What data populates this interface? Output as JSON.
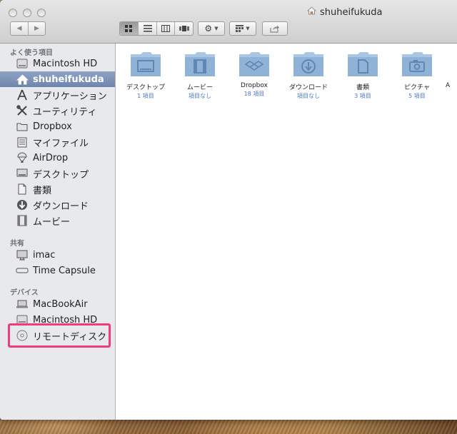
{
  "window": {
    "title": "shuheifukuda"
  },
  "toolbar": {
    "back_label": "◀",
    "forward_label": "▶"
  },
  "sidebar": {
    "favorites_title": "よく使う項目",
    "favorites": [
      {
        "label": "Macintosh HD",
        "icon": "hard-drive-icon"
      },
      {
        "label": "shuheifukuda",
        "icon": "home-icon",
        "selected": true
      },
      {
        "label": "アプリケーション",
        "icon": "applications-icon"
      },
      {
        "label": "ユーティリティ",
        "icon": "utilities-icon"
      },
      {
        "label": "Dropbox",
        "icon": "folder-icon"
      },
      {
        "label": "マイファイル",
        "icon": "all-my-files-icon"
      },
      {
        "label": "AirDrop",
        "icon": "airdrop-icon"
      },
      {
        "label": "デスクトップ",
        "icon": "desktop-icon"
      },
      {
        "label": "書類",
        "icon": "documents-icon"
      },
      {
        "label": "ダウンロード",
        "icon": "downloads-icon"
      },
      {
        "label": "ムービー",
        "icon": "movies-icon"
      }
    ],
    "shared_title": "共有",
    "shared": [
      {
        "label": "imac",
        "icon": "imac-icon"
      },
      {
        "label": "Time Capsule",
        "icon": "time-capsule-icon"
      }
    ],
    "devices_title": "デバイス",
    "devices": [
      {
        "label": "MacBookAir",
        "icon": "laptop-icon"
      },
      {
        "label": "Macintosh HD",
        "icon": "hard-drive-icon"
      },
      {
        "label": "リモートディスク",
        "icon": "remote-disc-icon"
      }
    ]
  },
  "content": {
    "folders": [
      {
        "name": "デスクトップ",
        "count": "1 項目",
        "icon": "desktop-folder-icon"
      },
      {
        "name": "ムービー",
        "count": "項目なし",
        "icon": "movies-folder-icon"
      },
      {
        "name": "Dropbox",
        "count": "18 項目",
        "icon": "dropbox-folder-icon"
      },
      {
        "name": "ダウンロード",
        "count": "項目なし",
        "icon": "downloads-folder-icon"
      },
      {
        "name": "書類",
        "count": "3 項目",
        "icon": "documents-folder-icon"
      },
      {
        "name": "ピクチャ",
        "count": "5 項目",
        "icon": "pictures-folder-icon"
      },
      {
        "name": "A",
        "count": "",
        "icon": "folder-icon"
      }
    ]
  },
  "colors": {
    "selection": "#7a90b6",
    "highlight_box": "#f03c7a",
    "folder_blue": "#8fb2d6",
    "count_text": "#4a78c2"
  }
}
